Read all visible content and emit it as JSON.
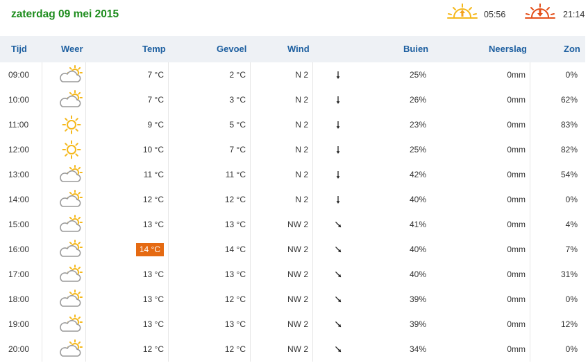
{
  "date": "zaterdag 09 mei 2015",
  "sun": {
    "sunrise": "05:56",
    "sunset": "21:14",
    "sunrise_icon": "sunrise-icon",
    "sunset_icon": "sunset-icon"
  },
  "colors": {
    "date": "#1c8c1c",
    "header_text": "#1d5fa0",
    "header_bg": "#eef1f5",
    "highlight": "#e56a12",
    "sun": "#f5b81c",
    "sunrise_arrow": "#f3a21c",
    "sunset_arrow": "#e4501b"
  },
  "headers": {
    "time": "Tijd",
    "weather": "Weer",
    "temp": "Temp",
    "feel": "Gevoel",
    "wind": "Wind",
    "rain": "Buien",
    "precip": "Neerslag",
    "sun": "Zon"
  },
  "rows": [
    {
      "time": "09:00",
      "icon": "partly-cloudy",
      "temp": "7 °C",
      "feel": "2 °C",
      "wind": "N 2",
      "dir": "N",
      "rain": "25%",
      "precip": "0mm",
      "sun": "0%",
      "highlight": false
    },
    {
      "time": "10:00",
      "icon": "partly-cloudy",
      "temp": "7 °C",
      "feel": "3 °C",
      "wind": "N 2",
      "dir": "N",
      "rain": "26%",
      "precip": "0mm",
      "sun": "62%",
      "highlight": false
    },
    {
      "time": "11:00",
      "icon": "sunny",
      "temp": "9 °C",
      "feel": "5 °C",
      "wind": "N 2",
      "dir": "N",
      "rain": "23%",
      "precip": "0mm",
      "sun": "83%",
      "highlight": false
    },
    {
      "time": "12:00",
      "icon": "sunny",
      "temp": "10 °C",
      "feel": "7 °C",
      "wind": "N 2",
      "dir": "N",
      "rain": "25%",
      "precip": "0mm",
      "sun": "82%",
      "highlight": false
    },
    {
      "time": "13:00",
      "icon": "partly-cloudy",
      "temp": "11 °C",
      "feel": "11 °C",
      "wind": "N 2",
      "dir": "N",
      "rain": "42%",
      "precip": "0mm",
      "sun": "54%",
      "highlight": false
    },
    {
      "time": "14:00",
      "icon": "partly-cloudy",
      "temp": "12 °C",
      "feel": "12 °C",
      "wind": "N 2",
      "dir": "N",
      "rain": "40%",
      "precip": "0mm",
      "sun": "0%",
      "highlight": false
    },
    {
      "time": "15:00",
      "icon": "partly-cloudy",
      "temp": "13 °C",
      "feel": "13 °C",
      "wind": "NW 2",
      "dir": "NW",
      "rain": "41%",
      "precip": "0mm",
      "sun": "4%",
      "highlight": false
    },
    {
      "time": "16:00",
      "icon": "partly-cloudy",
      "temp": "14 °C",
      "feel": "14 °C",
      "wind": "NW 2",
      "dir": "NW",
      "rain": "40%",
      "precip": "0mm",
      "sun": "7%",
      "highlight": true
    },
    {
      "time": "17:00",
      "icon": "partly-cloudy",
      "temp": "13 °C",
      "feel": "13 °C",
      "wind": "NW 2",
      "dir": "NW",
      "rain": "40%",
      "precip": "0mm",
      "sun": "31%",
      "highlight": false
    },
    {
      "time": "18:00",
      "icon": "partly-cloudy",
      "temp": "13 °C",
      "feel": "12 °C",
      "wind": "NW 2",
      "dir": "NW",
      "rain": "39%",
      "precip": "0mm",
      "sun": "0%",
      "highlight": false
    },
    {
      "time": "19:00",
      "icon": "partly-cloudy",
      "temp": "13 °C",
      "feel": "13 °C",
      "wind": "NW 2",
      "dir": "NW",
      "rain": "39%",
      "precip": "0mm",
      "sun": "12%",
      "highlight": false
    },
    {
      "time": "20:00",
      "icon": "partly-cloudy",
      "temp": "12 °C",
      "feel": "12 °C",
      "wind": "NW 2",
      "dir": "NW",
      "rain": "34%",
      "precip": "0mm",
      "sun": "0%",
      "highlight": false
    }
  ]
}
